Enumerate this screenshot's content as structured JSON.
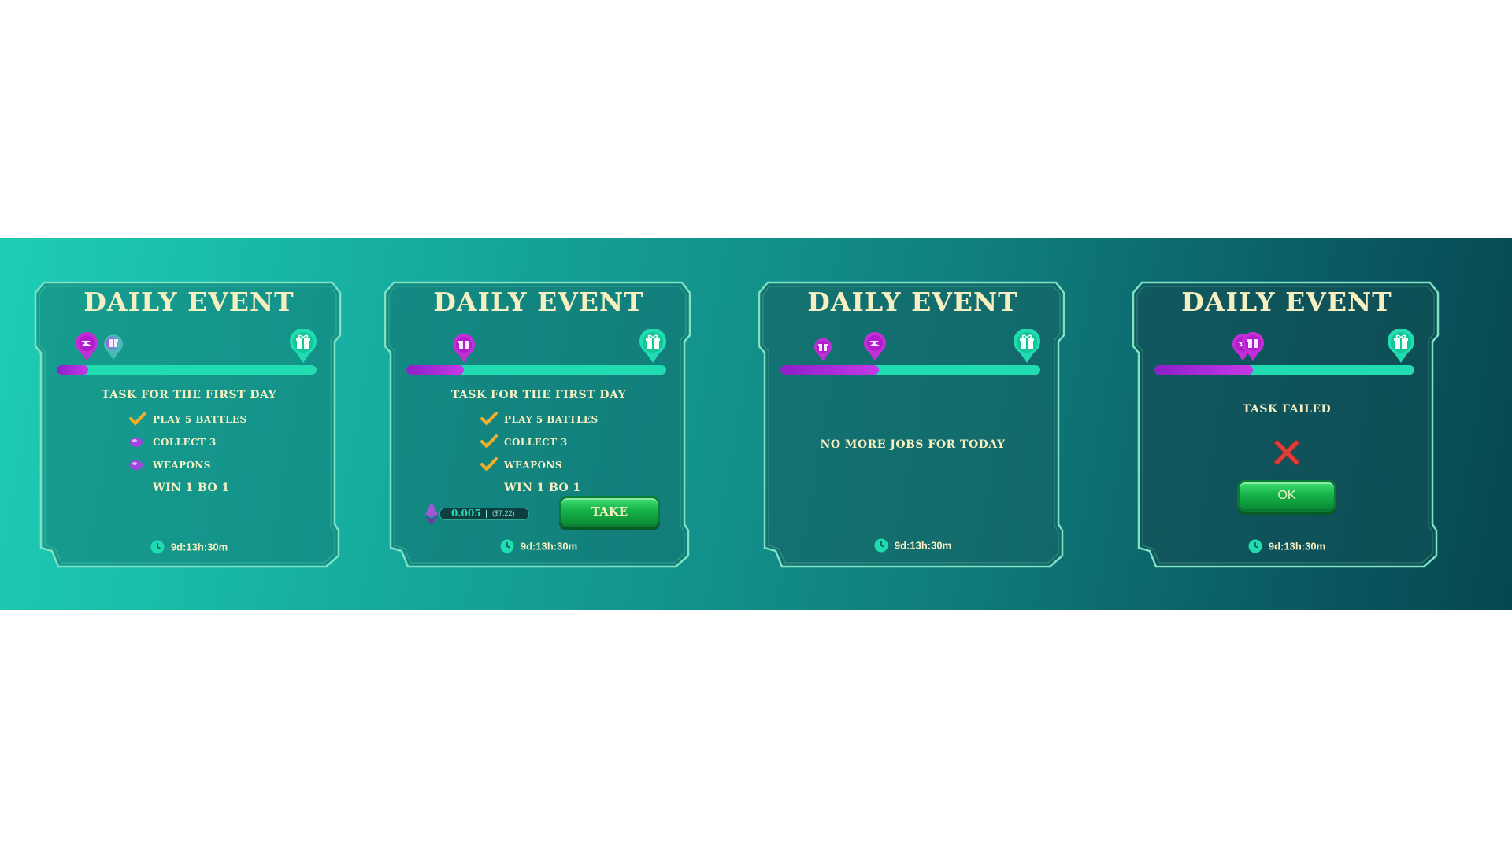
{
  "colors": {
    "band_start": "#1ecdb6",
    "band_end": "#064650",
    "title": "#f5efc2",
    "progress_track": "#20dcb0",
    "progress_fill": "#b02fd8",
    "check": "#f2ad2a",
    "fail": "#d9413a",
    "button": "#16b34a"
  },
  "cards": [
    {
      "title": "DAILY EVENT",
      "progress": 0.12,
      "milestones": [
        "lightning-icon",
        "gift-icon",
        "gift-icon"
      ],
      "subtitle": "TASK FOR THE FIRST DAY",
      "tasks": [
        {
          "label": "PLAY 5 BATTLES",
          "status": "done",
          "icon": "check-icon"
        },
        {
          "label": "COLLECT 3",
          "status": "pending",
          "icon": "purple-gem-icon"
        },
        {
          "label": "WEAPONS",
          "status": "pending",
          "icon": "purple-gem-icon"
        },
        {
          "label": "WIN 1 BO 1",
          "status": "pending",
          "icon": ""
        }
      ],
      "timer": "9d:13h:30m"
    },
    {
      "title": "DAILY EVENT",
      "progress": 0.22,
      "milestones": [
        "gift-icon",
        "gift-icon"
      ],
      "subtitle": "TASK FOR THE FIRST DAY",
      "tasks": [
        {
          "label": "PLAY 5 BATTLES",
          "status": "done",
          "icon": "check-icon"
        },
        {
          "label": "COLLECT 3",
          "status": "done",
          "icon": "check-icon"
        },
        {
          "label": "WEAPONS",
          "status": "done",
          "icon": "check-icon"
        },
        {
          "label": "WIN 1 BO 1",
          "status": "pending",
          "icon": ""
        }
      ],
      "reward": {
        "amount": "0.005",
        "usd": "($7.22)",
        "icon": "ethereum-icon"
      },
      "take_label": "TAKE",
      "timer": "9d:13h:30m"
    },
    {
      "title": "DAILY EVENT",
      "progress": 0.38,
      "milestones": [
        "gift-icon",
        "lightning-icon",
        "gift-icon"
      ],
      "message": "NO MORE JOBS FOR TODAY",
      "timer": "9d:13h:30m"
    },
    {
      "title": "DAILY EVENT",
      "progress": 0.38,
      "milestones": [
        "lightning-icon",
        "gift-icon",
        "gift-icon"
      ],
      "status_text": "TASK FAILED",
      "ok_label": "OK",
      "timer": "9d:13h:30m"
    }
  ]
}
